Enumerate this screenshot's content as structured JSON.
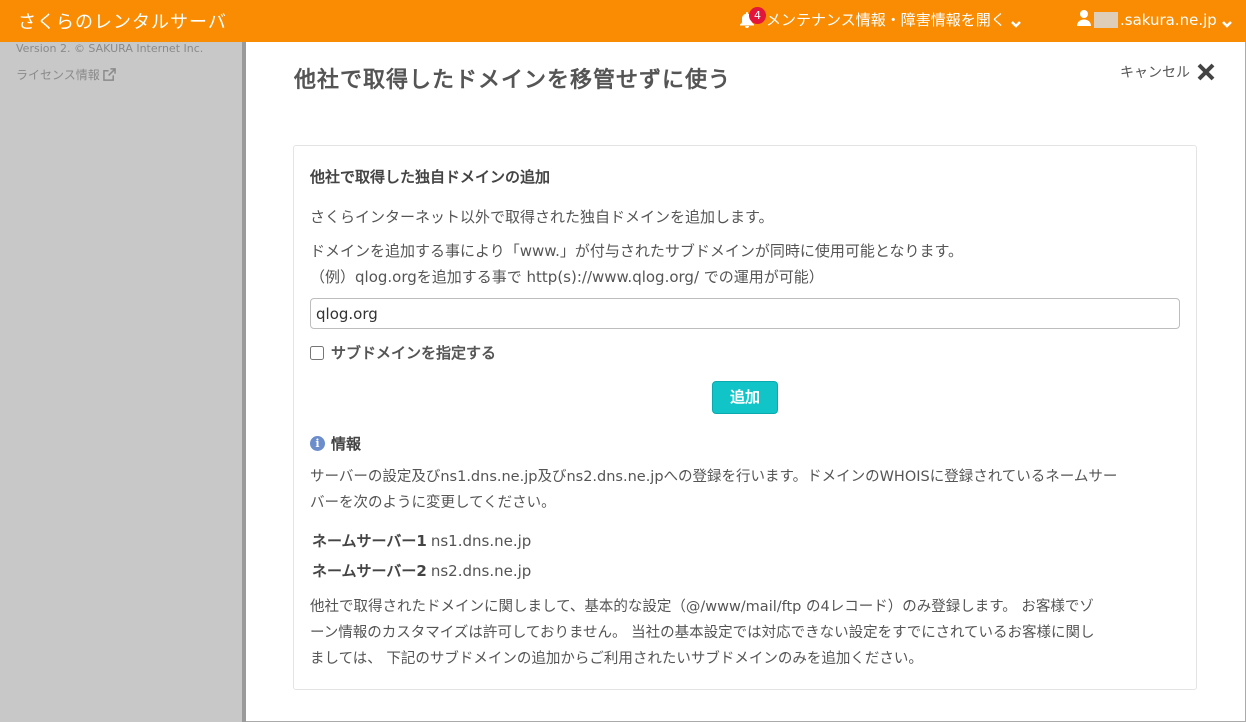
{
  "header": {
    "brand": "さくらのレンタルサーバ",
    "notice_badge": "4",
    "notice_label": "メンテナンス情報・障害情報を開く",
    "user_domain": ".sakura.ne.jp"
  },
  "sidebar": {
    "version": "Version 2. © SAKURA Internet Inc.",
    "license": "ライセンス情報"
  },
  "main": {
    "page_title": "他社で取得したドメインを移管せずに使う",
    "cancel_label": "キャンセル"
  },
  "card": {
    "title": "他社で取得した独自ドメインの追加",
    "desc1": "さくらインターネット以外で取得された独自ドメインを追加します。",
    "desc2": "ドメインを追加する事により「www.」が付与されたサブドメインが同時に使用可能となります。",
    "desc3": "（例）qlog.orgを追加する事で http(s)://www.qlog.org/ での運用が可能）",
    "domain_input_value": "qlog.org",
    "subdomain_checkbox_label": "サブドメインを指定する",
    "add_button_label": "追加",
    "info_title": "情報",
    "info_line1": "サーバーの設定及びns1.dns.ne.jp及びns2.dns.ne.jpへの登録を行います。ドメインのWHOISに登録されているネームサー",
    "info_line2": "バーを次のように変更してください。",
    "ns1_label": "ネームサーバー1",
    "ns1_value": "ns1.dns.ne.jp",
    "ns2_label": "ネームサーバー2",
    "ns2_value": "ns2.dns.ne.jp",
    "note_line1": "他社で取得されたドメインに関しまして、基本的な設定（@/www/mail/ftp の4レコード）のみ登録します。 お客様でゾ",
    "note_line2": "ーン情報のカスタマイズは許可しておりません。 当社の基本設定では対応できない設定をすでにされているお客様に関し",
    "note_line3": "ましては、 下記のサブドメインの追加からご利用されたいサブドメインのみを追加ください。"
  }
}
